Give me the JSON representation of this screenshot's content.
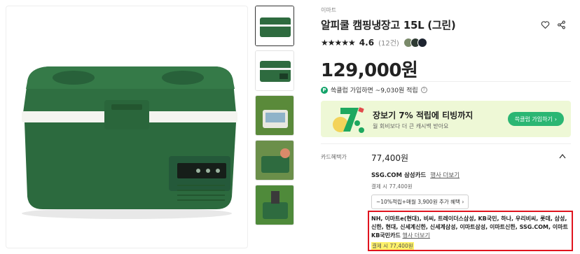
{
  "product": {
    "brand": "이마트",
    "title": "알피쿨 캠핑냉장고 15L (그린)",
    "rating_stars": "★★★★★",
    "rating_score": "4.6",
    "review_count": "(12건)",
    "price": "129,000원"
  },
  "points": {
    "badge": "P",
    "text": "쓱클럽 가입하면 ~9,030원 적립",
    "help": "?"
  },
  "banner": {
    "title": "장보기 7% 적립에 티빙까지",
    "subtitle": "월 회비보다 더 큰 캐시백 받아요",
    "button_label": "쓱클럽 가입하기",
    "button_arrow": "›",
    "accent": "#2bb673",
    "background": "#eef8d6"
  },
  "card_benefit": {
    "label": "카드혜택가",
    "total": "77,400원",
    "card_name": "SSG.COM 삼성카드",
    "more_link": "행사 더보기",
    "pay_text": "결제 시 77,400원",
    "chip_text": "~10%적립+매월 3,900원 추가 혜택",
    "chip_arrow": "›"
  },
  "partner_cards": {
    "list_text": "NH, 이마트e(현대), 비씨, 트레이더스삼성, KB국민, 하나, 우리비씨, 롯데, 삼성, 신한, 현대, 신세계신한, 신세계삼성, 이마트삼성, 이마트신한, SSG.COM, 이마트KB국민카드",
    "more_link": "행사 더보기",
    "pay_text": "결제 시 77,400원"
  },
  "colors": {
    "product_green": "#2e6b3f",
    "highlight_border": "#e0141e",
    "highlight_fill": "#fff26b"
  },
  "icons": [
    "heart-icon",
    "share-icon",
    "chevron-up-icon",
    "help-icon"
  ]
}
